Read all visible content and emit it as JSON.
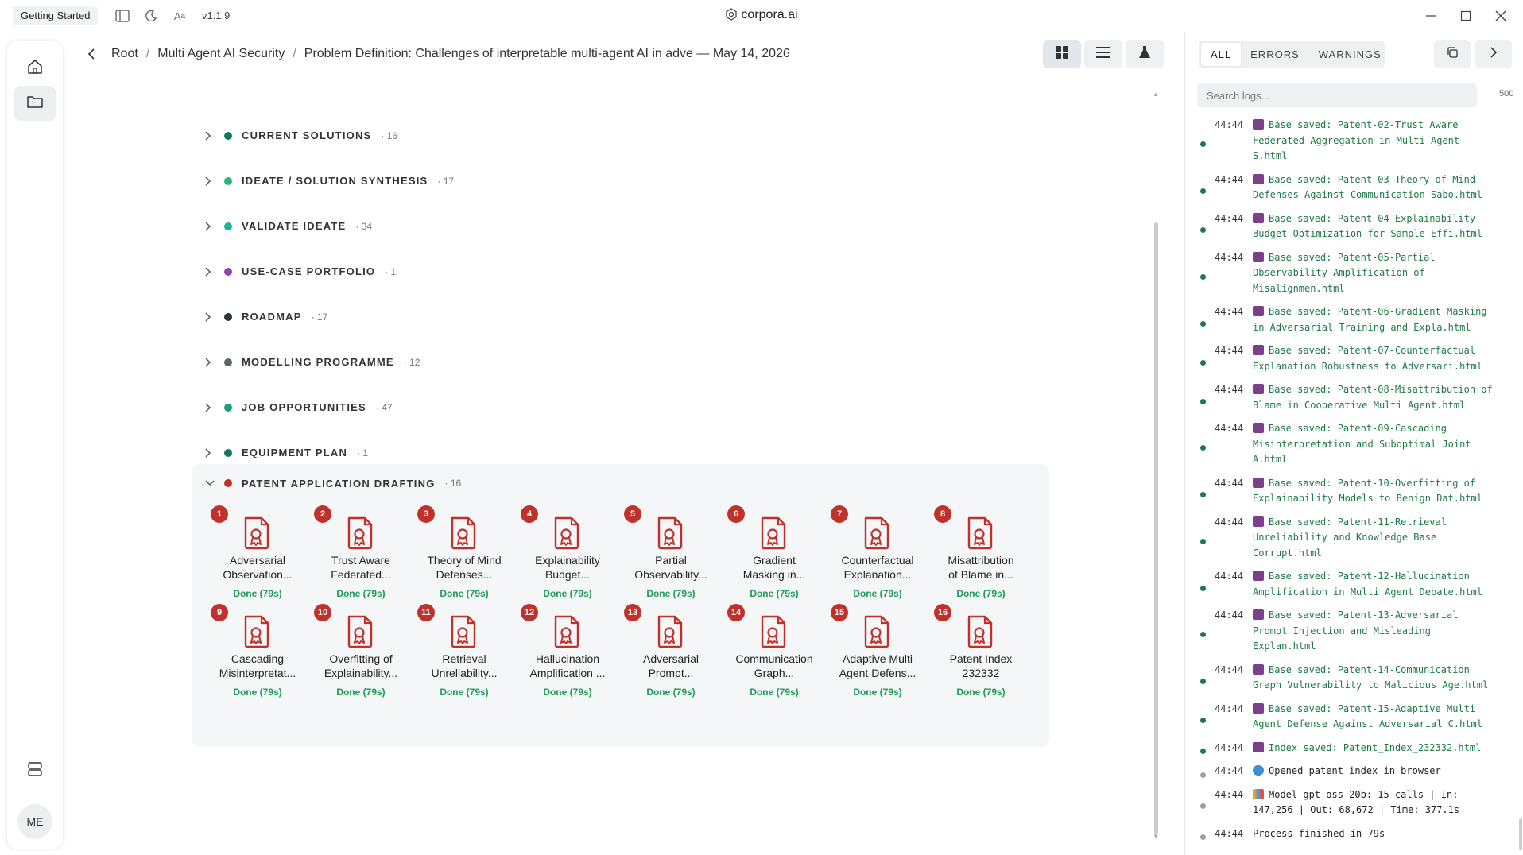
{
  "titlebar": {
    "getting_started": "Getting Started",
    "version": "v1.1.9",
    "app_title": "corpora.ai"
  },
  "breadcrumb": {
    "items": [
      "Root",
      "Multi Agent AI Security",
      "Problem Definition: Challenges of interpretable multi-agent AI in adve — May 14, 2026"
    ]
  },
  "user": {
    "initials": "ME"
  },
  "sections": [
    {
      "label": "CURRENT SOLUTIONS",
      "count": "· 16",
      "color": "#127a66"
    },
    {
      "label": "IDEATE / SOLUTION SYNTHESIS",
      "count": "· 17",
      "color": "#2bb573"
    },
    {
      "label": "VALIDATE IDEATE",
      "count": "· 34",
      "color": "#1fb39a"
    },
    {
      "label": "USE-CASE PORTFOLIO",
      "count": "· 1",
      "color": "#8e44ad"
    },
    {
      "label": "ROADMAP",
      "count": "· 17",
      "color": "#2d3440"
    },
    {
      "label": "MODELLING PROGRAMME",
      "count": "· 12",
      "color": "#5d6570"
    },
    {
      "label": "JOB OPPORTUNITIES",
      "count": "· 47",
      "color": "#1a9e7f"
    },
    {
      "label": "EQUIPMENT PLAN",
      "count": "· 1",
      "color": "#117a5e"
    }
  ],
  "patent_section": {
    "label": "PATENT APPLICATION DRAFTING",
    "count": "· 16",
    "color": "#c0312b",
    "items": [
      {
        "n": "1",
        "line1": "Adversarial",
        "line2": "Observation...",
        "status": "Done (79s)"
      },
      {
        "n": "2",
        "line1": "Trust Aware",
        "line2": "Federated...",
        "status": "Done (79s)"
      },
      {
        "n": "3",
        "line1": "Theory of Mind",
        "line2": "Defenses...",
        "status": "Done (79s)"
      },
      {
        "n": "4",
        "line1": "Explainability",
        "line2": "Budget...",
        "status": "Done (79s)"
      },
      {
        "n": "5",
        "line1": "Partial",
        "line2": "Observability...",
        "status": "Done (79s)"
      },
      {
        "n": "6",
        "line1": "Gradient",
        "line2": "Masking in...",
        "status": "Done (79s)"
      },
      {
        "n": "7",
        "line1": "Counterfactual",
        "line2": "Explanation...",
        "status": "Done (79s)"
      },
      {
        "n": "8",
        "line1": "Misattribution",
        "line2": "of Blame in...",
        "status": "Done (79s)"
      },
      {
        "n": "9",
        "line1": "Cascading",
        "line2": "Misinterpretat...",
        "status": "Done (79s)"
      },
      {
        "n": "10",
        "line1": "Overfitting of",
        "line2": "Explainability...",
        "status": "Done (79s)"
      },
      {
        "n": "11",
        "line1": "Retrieval",
        "line2": "Unreliability...",
        "status": "Done (79s)"
      },
      {
        "n": "12",
        "line1": "Hallucination",
        "line2": "Amplification ...",
        "status": "Done (79s)"
      },
      {
        "n": "13",
        "line1": "Adversarial",
        "line2": "Prompt...",
        "status": "Done (79s)"
      },
      {
        "n": "14",
        "line1": "Communication",
        "line2": "Graph...",
        "status": "Done (79s)"
      },
      {
        "n": "15",
        "line1": "Adaptive Multi",
        "line2": "Agent Defens...",
        "status": "Done (79s)"
      },
      {
        "n": "16",
        "line1": "Patent Index",
        "line2": "232332",
        "status": "Done (79s)"
      }
    ]
  },
  "logs": {
    "tabs": [
      "ALL",
      "ERRORS",
      "WARNINGS"
    ],
    "search_placeholder": "Search logs...",
    "limit": "500",
    "entries": [
      {
        "time": "44:44",
        "icon": "save",
        "text": "Base saved: Patent-02-Trust Aware Federated Aggregation in Multi Agent S.html",
        "dot": "#1e7a45",
        "lines": 3
      },
      {
        "time": "44:44",
        "icon": "save",
        "text": "Base saved: Patent-03-Theory of Mind Defenses Against Communication Sabo.html",
        "dot": "#1e7a45",
        "lines": 2
      },
      {
        "time": "44:44",
        "icon": "save",
        "text": "Base saved: Patent-04-Explainability Budget Optimization for Sample Effi.html",
        "dot": "#1e7a45",
        "lines": 2
      },
      {
        "time": "44:44",
        "icon": "save",
        "text": "Base saved: Patent-05-Partial Observability Amplification of Misalignmen.html",
        "dot": "#1e7a45",
        "lines": 3
      },
      {
        "time": "44:44",
        "icon": "save",
        "text": "Base saved: Patent-06-Gradient Masking in Adversarial Training and Expla.html",
        "dot": "#1e7a45",
        "lines": 2
      },
      {
        "time": "44:44",
        "icon": "save",
        "text": "Base saved: Patent-07-Counterfactual Explanation Robustness to Adversari.html",
        "dot": "#1e7a45",
        "lines": 2
      },
      {
        "time": "44:44",
        "icon": "save",
        "text": "Base saved: Patent-08-Misattribution of Blame in Cooperative Multi Agent.html",
        "dot": "#1e7a45",
        "lines": 2
      },
      {
        "time": "44:44",
        "icon": "save",
        "text": "Base saved: Patent-09-Cascading Misinterpretation and Suboptimal Joint A.html",
        "dot": "#1e7a45",
        "lines": 3
      },
      {
        "time": "44:44",
        "icon": "save",
        "text": "Base saved: Patent-10-Overfitting of Explainability Models to Benign Dat.html",
        "dot": "#1e7a45",
        "lines": 2
      },
      {
        "time": "44:44",
        "icon": "save",
        "text": "Base saved: Patent-11-Retrieval Unreliability and Knowledge Base Corrupt.html",
        "dot": "#1e7a45",
        "lines": 3
      },
      {
        "time": "44:44",
        "icon": "save",
        "text": "Base saved: Patent-12-Hallucination Amplification in Multi Agent Debate.html",
        "dot": "#1e7a45",
        "lines": 2
      },
      {
        "time": "44:44",
        "icon": "save",
        "text": "Base saved: Patent-13-Adversarial Prompt Injection and Misleading Explan.html",
        "dot": "#1e7a45",
        "lines": 3
      },
      {
        "time": "44:44",
        "icon": "save",
        "text": "Base saved: Patent-14-Communication Graph Vulnerability to Malicious Age.html",
        "dot": "#1e7a45",
        "lines": 2
      },
      {
        "time": "44:44",
        "icon": "save",
        "text": "Base saved: Patent-15-Adaptive Multi Agent Defense Against Adversarial C.html",
        "dot": "#1e7a45",
        "lines": 2
      },
      {
        "time": "44:44",
        "icon": "save",
        "text": "Index saved: Patent_Index_232332.html",
        "dot": "#1e7a45",
        "lines": 1
      },
      {
        "time": "44:44",
        "icon": "globe",
        "text": "Opened patent index in browser",
        "dot": "#9aa0a6",
        "lines": 1,
        "plain": true
      },
      {
        "time": "44:44",
        "icon": "chart",
        "text": "Model gpt-oss-20b: 15 calls | In: 147,256 | Out: 68,672 | Time: 377.1s",
        "dot": "#9aa0a6",
        "lines": 2,
        "plain": true
      },
      {
        "time": "44:44",
        "icon": "",
        "text": "Process finished in 79s",
        "dot": "#9aa0a6",
        "lines": 1,
        "plain": true
      }
    ]
  },
  "colors": {
    "patent_red": "#c0312b",
    "done_green": "#1f9a55",
    "log_green": "#1e7a45"
  }
}
